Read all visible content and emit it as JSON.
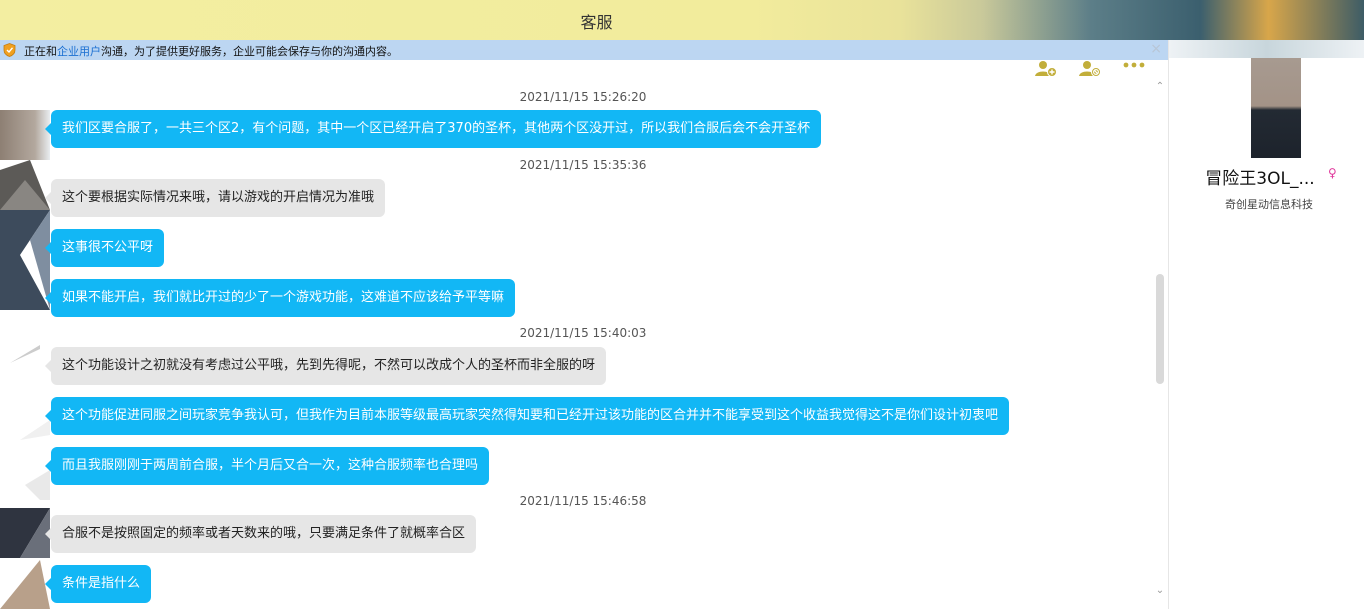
{
  "window": {
    "title": "客服"
  },
  "notice": {
    "prefix": "正在和",
    "highlight": "企业用户",
    "suffix": "沟通，为了提供更好服务，企业可能会保存与你的沟通内容。",
    "close_label": "×"
  },
  "toolbar": {
    "icons": [
      "add-contact-icon",
      "block-contact-icon",
      "more-icon"
    ]
  },
  "messages": [
    {
      "type": "timestamp",
      "text": "2021/11/15 15:26:20"
    },
    {
      "type": "mine",
      "text": "我们区要合服了，一共三个区2，有个问题，其中一个区已经开启了370的圣杯，其他两个区没开过，所以我们合服后会不会开圣杯"
    },
    {
      "type": "timestamp",
      "text": "2021/11/15 15:35:36"
    },
    {
      "type": "theirs",
      "text": "这个要根据实际情况来哦，请以游戏的开启情况为准哦"
    },
    {
      "type": "mine",
      "text": "这事很不公平呀"
    },
    {
      "type": "mine",
      "text": "如果不能开启，我们就比开过的少了一个游戏功能，这难道不应该给予平等嘛"
    },
    {
      "type": "timestamp",
      "text": "2021/11/15 15:40:03"
    },
    {
      "type": "theirs",
      "text": "这个功能设计之初就没有考虑过公平哦，先到先得呢，不然可以改成个人的圣杯而非全服的呀"
    },
    {
      "type": "mine",
      "text": "这个功能促进同服之间玩家竞争我认可，但我作为目前本服等级最高玩家突然得知要和已经开过该功能的区合并并不能享受到这个收益我觉得这不是你们设计初衷吧"
    },
    {
      "type": "mine",
      "text": "而且我服刚刚于两周前合服，半个月后又合一次，这种合服频率也合理吗"
    },
    {
      "type": "timestamp",
      "text": "2021/11/15 15:46:58"
    },
    {
      "type": "theirs",
      "text": "合服不是按照固定的频率或者天数来的哦，只要满足条件了就概率合区"
    },
    {
      "type": "mine",
      "text": "条件是指什么"
    }
  ],
  "profile": {
    "name": "冒险王3OL_...",
    "gender_symbol": "♀",
    "company": "奇创星动信息科技"
  },
  "colors": {
    "my_bubble": "#12b7f5",
    "their_bubble": "#e6e6e6",
    "notice_bg": "#bcd6f2",
    "link": "#1a6fd1"
  }
}
